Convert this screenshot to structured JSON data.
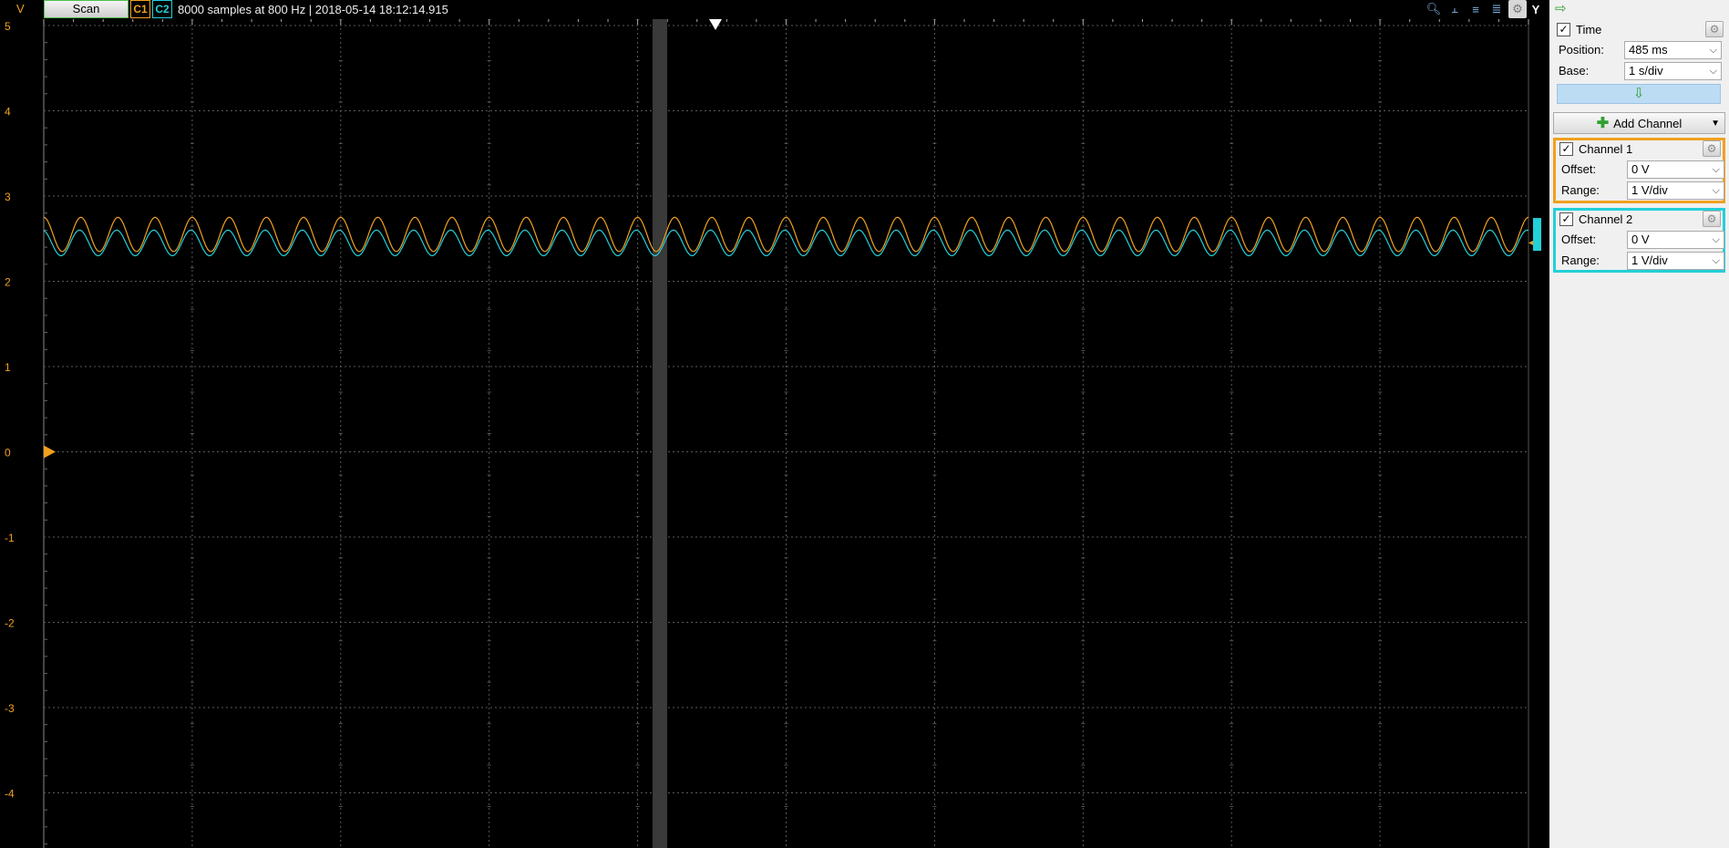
{
  "topbar": {
    "unit_label": "V",
    "scan_label": "Scan",
    "c1_label": "C1",
    "c2_label": "C2",
    "status": "8000 samples at 800 Hz | 2018-05-14 18:12:14.915",
    "y_label": "Y",
    "icons": [
      "zoom-icon",
      "cursor-x-icon",
      "cursor-align-icon",
      "cursor-multi-icon",
      "gear-icon"
    ]
  },
  "panel": {
    "arrow_icon": "green-right-arrow",
    "time": {
      "title": "Time",
      "checked": true,
      "position_label": "Position:",
      "position_value": "485 ms",
      "base_label": "Base:",
      "base_value": "1 s/div"
    },
    "add_channel_label": "Add Channel",
    "channel1": {
      "title": "Channel 1",
      "checked": true,
      "offset_label": "Offset:",
      "offset_value": "0 V",
      "range_label": "Range:",
      "range_value": "1 V/div",
      "color": "#f0a020"
    },
    "channel2": {
      "title": "Channel 2",
      "checked": true,
      "offset_label": "Offset:",
      "offset_value": "0 V",
      "range_label": "Range:",
      "range_value": "1 V/div",
      "color": "#22d0d8"
    }
  },
  "chart_data": {
    "type": "line",
    "ylabel": "V",
    "ylim": [
      -4.8,
      5
    ],
    "yticks": [
      "5",
      "4",
      "3",
      "2",
      "1",
      "0",
      "-1",
      "-2",
      "-3",
      "-4"
    ],
    "grid": true,
    "cycles": 40,
    "series": [
      {
        "name": "C1",
        "color": "#f0a020",
        "center": 2.55,
        "amplitude": 0.2,
        "phase": 0
      },
      {
        "name": "C2",
        "color": "#22d0d8",
        "center": 2.45,
        "amplitude": 0.15,
        "phase": 0.35
      }
    ]
  }
}
